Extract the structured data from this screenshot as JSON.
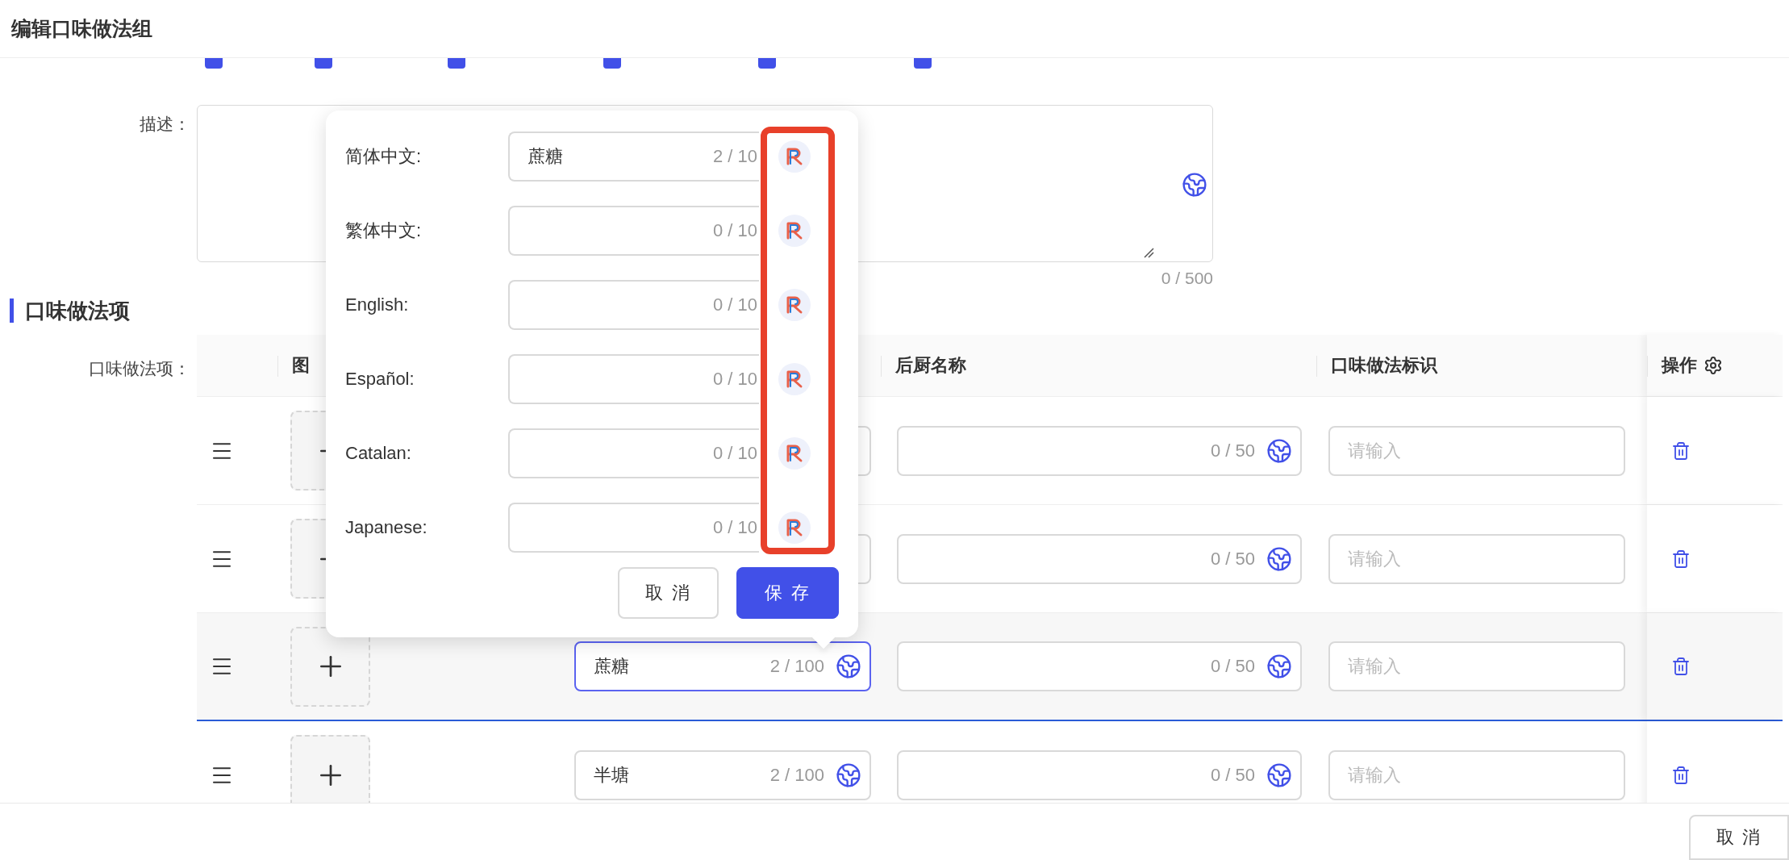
{
  "header": {
    "title": "编辑口味做法组"
  },
  "channels": {
    "checkboxes": [
      {
        "checked": true
      },
      {
        "checked": true
      },
      {
        "checked": true
      },
      {
        "checked": true
      },
      {
        "checked": true
      },
      {
        "checked": true
      }
    ]
  },
  "description": {
    "label": "描述：",
    "counter": "0 / 500"
  },
  "section": {
    "title": "口味做法项"
  },
  "table": {
    "label": "口味做法项：",
    "columns": [
      {
        "kind": "drag"
      },
      {
        "kind": "image",
        "label": "图"
      },
      {
        "kind": "name"
      },
      {
        "kind": "kitchen",
        "label": "后厨名称"
      },
      {
        "kind": "code",
        "label": "口味做法标识"
      },
      {
        "kind": "ops",
        "label": "操作"
      }
    ],
    "rows": [
      {
        "selected": false,
        "kitchen_counter": "0 / 50",
        "code_placeholder": "请输入"
      },
      {
        "selected": false,
        "kitchen_counter": "0 / 50",
        "code_placeholder": "请输入"
      },
      {
        "selected": true,
        "name": "蔗糖",
        "name_counter": "2 / 100",
        "kitchen_counter": "0 / 50",
        "code_placeholder": "请输入"
      },
      {
        "selected": false,
        "name": "半塘",
        "name_counter": "2 / 100",
        "kitchen_counter": "0 / 50",
        "code_placeholder": "请输入"
      }
    ]
  },
  "popover": {
    "fields": [
      {
        "label": "简体中文:",
        "value": "蔗糖",
        "counter": "2 / 10"
      },
      {
        "label": "繁体中文:",
        "counter": "0 / 10"
      },
      {
        "label": "English:",
        "counter": "0 / 10"
      },
      {
        "label": "Español:",
        "counter": "0 / 10"
      },
      {
        "label": "Catalan:",
        "counter": "0 / 10"
      },
      {
        "label": "Japanese:",
        "counter": "0 / 10"
      }
    ],
    "buttons": [
      {
        "kind": "secondary",
        "label": "取 消"
      },
      {
        "kind": "primary",
        "label": "保 存"
      }
    ]
  },
  "footer": {
    "buttons": [
      {
        "label": "取 消"
      }
    ]
  }
}
